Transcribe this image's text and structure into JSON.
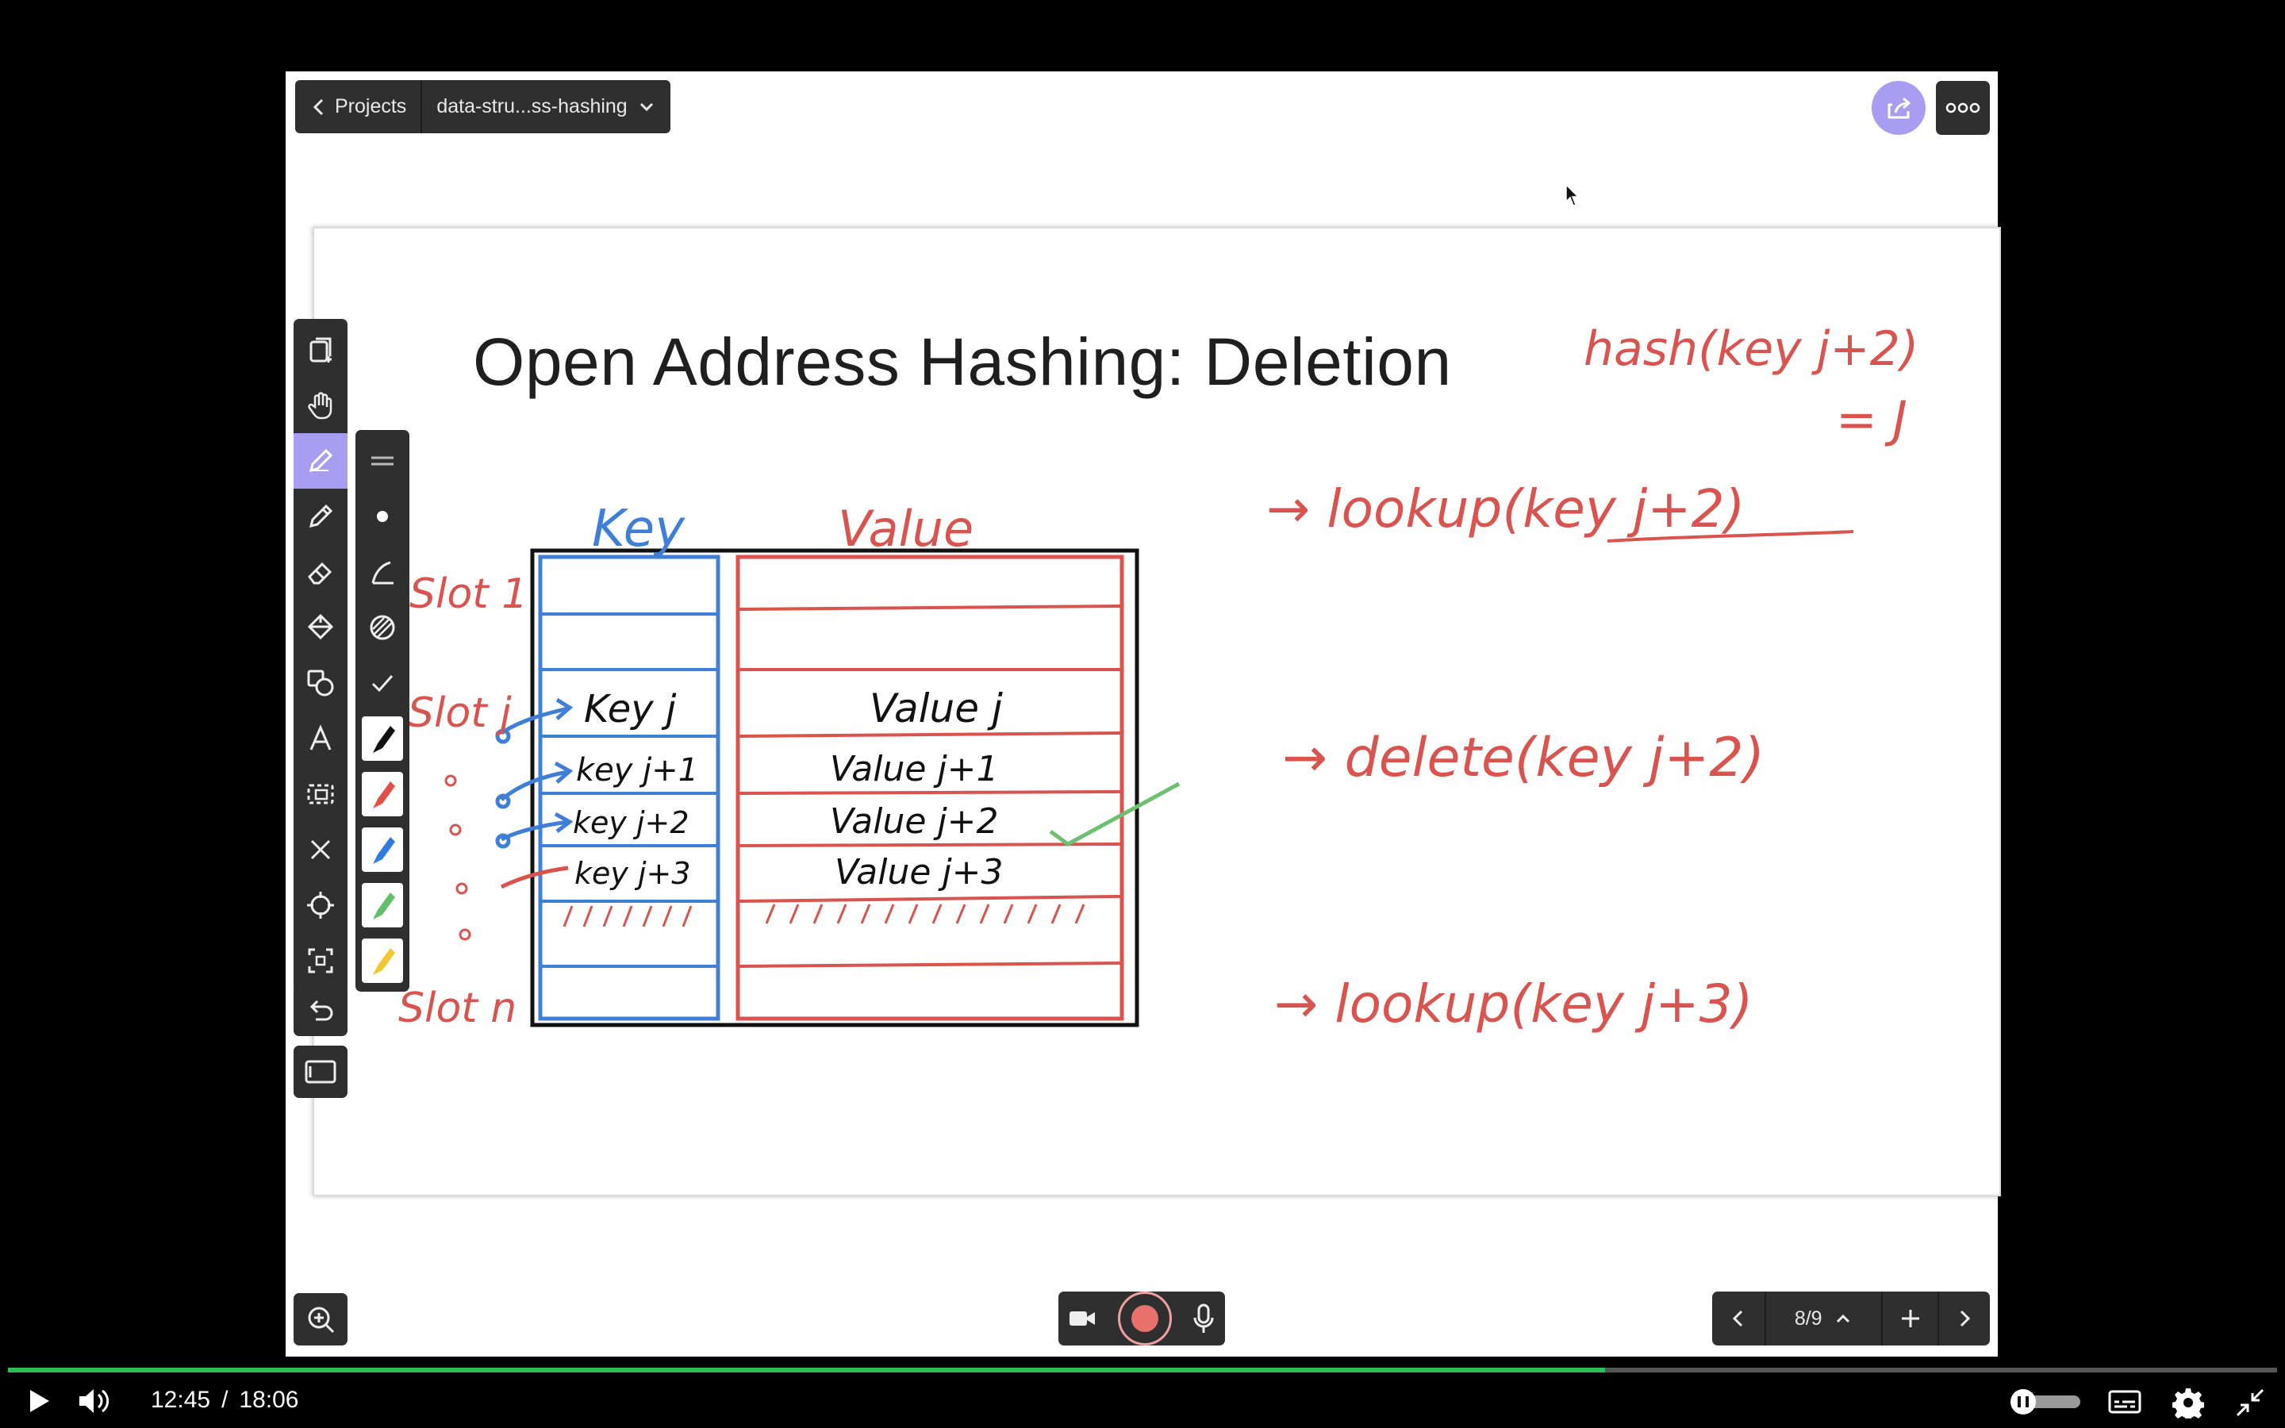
{
  "app": {
    "back_label": "Projects",
    "project_name": "data-stru...ss-hashing"
  },
  "slide": {
    "title": "Open Address Hashing: Deletion",
    "headers": {
      "key": "Key",
      "value": "Value"
    },
    "slot_labels": [
      "Slot 1",
      "Slot j",
      "Slot n"
    ],
    "rows": [
      {
        "key": "Key j",
        "value": "Value j"
      },
      {
        "key": "key j+1",
        "value": "Value j+1"
      },
      {
        "key": "key j+2",
        "value": "Value j+2"
      },
      {
        "key": "key j+3",
        "value": "Value j+3"
      }
    ],
    "annotations": {
      "hash": "hash(key j+2)",
      "hash_result": "= J",
      "lookup1": "→ lookup(key j+2)",
      "delete": "→ delete(key j+2)",
      "lookup2": "→ lookup(key j+3)"
    }
  },
  "pager": {
    "page": "8/9"
  },
  "player": {
    "current_time": "12:45",
    "separator": "/",
    "duration": "18:06",
    "progress": 0.704
  },
  "colors": {
    "ink_red": "#d9534f",
    "ink_blue": "#3f7fd8",
    "ink_black": "#111111",
    "ink_green": "#6cc070",
    "accent": "#a89df0",
    "toolbar": "#2f2f2f"
  },
  "icons": {
    "tools": [
      "copy-add-icon",
      "hand-icon",
      "pen-icon",
      "pencil-icon",
      "eraser-icon",
      "fill-icon",
      "shapes-icon",
      "text-icon",
      "select-icon",
      "close-icon",
      "laser-icon",
      "screenshot-icon"
    ],
    "subtools": [
      "menu-lines-icon",
      "dot-icon",
      "stroke-icon",
      "opacity-icon",
      "check-icon"
    ],
    "swatches": [
      "black",
      "red",
      "blue",
      "green",
      "yellow"
    ]
  }
}
